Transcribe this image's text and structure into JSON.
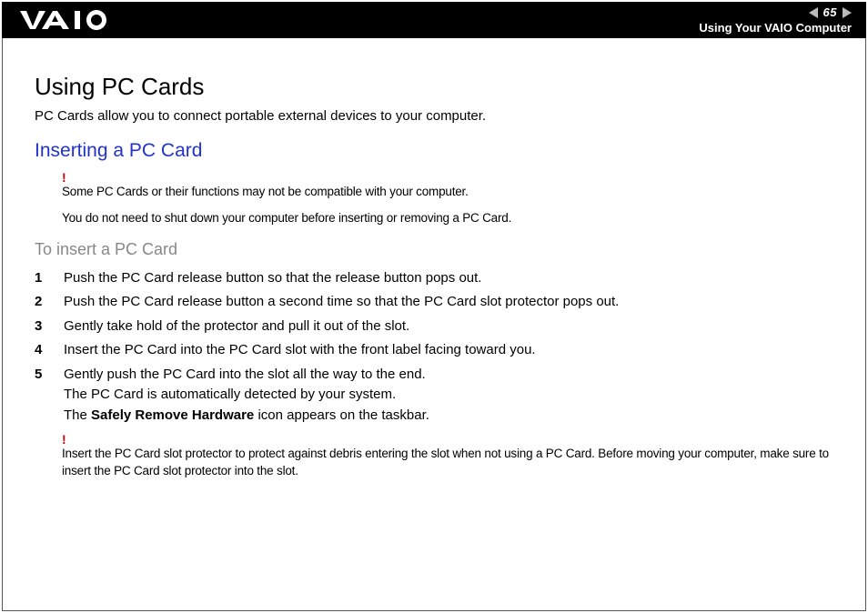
{
  "header": {
    "page_number": "65",
    "section": "Using Your VAIO Computer"
  },
  "main": {
    "title": "Using PC Cards",
    "intro": "PC Cards allow you to connect portable external devices to your computer.",
    "subtitle": "Inserting a PC Card",
    "warning_mark": "!",
    "notes": {
      "compat": "Some PC Cards or their functions may not be compatible with your computer.",
      "shutdown": "You do not need to shut down your computer before inserting or removing a PC Card."
    },
    "procedure_title": "To insert a PC Card",
    "steps": {
      "s1": "Push the PC Card release button so that the release button pops out.",
      "s2": "Push the PC Card release button a second time so that the PC Card slot protector pops out.",
      "s3": "Gently take hold of the protector and pull it out of the slot.",
      "s4": "Insert the PC Card into the PC Card slot with the front label facing toward you.",
      "s5a": "Gently push the PC Card into the slot all the way to the end.",
      "s5b": "The PC Card is automatically detected by your system.",
      "s5c_pre": "The ",
      "s5c_bold": "Safely Remove Hardware",
      "s5c_post": " icon appears on the taskbar."
    },
    "footer_note": "Insert the PC Card slot protector to protect against debris entering the slot when not using a PC Card. Before moving your computer, make sure to insert the PC Card slot protector into the slot."
  }
}
